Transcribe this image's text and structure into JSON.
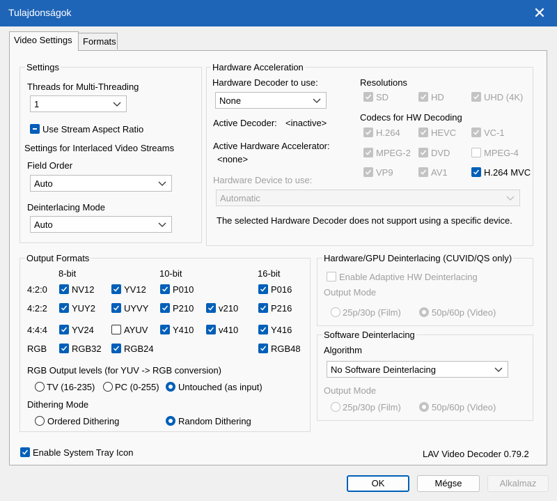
{
  "window": {
    "title": "Tulajdonságok"
  },
  "tabs": [
    "Video Settings",
    "Formats"
  ],
  "settings": {
    "title": "Settings",
    "threads_label": "Threads for Multi-Threading",
    "threads_value": "1",
    "aspect_label": "Use Stream Aspect Ratio",
    "interlaced_label": "Settings for Interlaced Video Streams",
    "field_order_label": "Field Order",
    "field_order_value": "Auto",
    "deint_mode_label": "Deinterlacing Mode",
    "deint_mode_value": "Auto"
  },
  "hwaccel": {
    "title": "Hardware Acceleration",
    "decoder_label": "Hardware Decoder to use:",
    "decoder_value": "None",
    "active_decoder_label": "Active Decoder:",
    "active_decoder_value": "<inactive>",
    "active_accel_label": "Active Hardware Accelerator:",
    "active_accel_value": "<none>",
    "device_label": "Hardware Device to use:",
    "device_value": "Automatic",
    "device_note": "The selected Hardware Decoder does not support using a specific device.",
    "resolutions_label": "Resolutions",
    "res_sd": "SD",
    "res_hd": "HD",
    "res_uhd": "UHD (4K)",
    "codecs_label": "Codecs for HW Decoding",
    "c_h264": "H.264",
    "c_hevc": "HEVC",
    "c_vc1": "VC-1",
    "c_mpeg2": "MPEG-2",
    "c_dvd": "DVD",
    "c_mpeg4": "MPEG-4",
    "c_vp9": "VP9",
    "c_av1": "AV1",
    "c_h264mvc": "H.264 MVC"
  },
  "output": {
    "title": "Output Formats",
    "h8": "8-bit",
    "h10": "10-bit",
    "h16": "16-bit",
    "r420": "4:2:0",
    "r422": "4:2:2",
    "r444": "4:4:4",
    "rrgb": "RGB",
    "nv12": "NV12",
    "yv12": "YV12",
    "p010": "P010",
    "p016": "P016",
    "yuy2": "YUY2",
    "uyvy": "UYVY",
    "p210": "P210",
    "v210": "v210",
    "p216": "P216",
    "yv24": "YV24",
    "ayuv": "AYUV",
    "y410": "Y410",
    "v410": "v410",
    "y416": "Y416",
    "rgb32": "RGB32",
    "rgb24": "RGB24",
    "rgb48": "RGB48",
    "levels_label": "RGB Output levels (for YUV -> RGB conversion)",
    "lv_tv": "TV (16-235)",
    "lv_pc": "PC (0-255)",
    "lv_untouched": "Untouched (as input)",
    "dither_label": "Dithering Mode",
    "dither_ordered": "Ordered Dithering",
    "dither_random": "Random Dithering"
  },
  "hwdeint": {
    "title": "Hardware/GPU Deinterlacing (CUVID/QS only)",
    "adaptive_label": "Enable Adaptive HW Deinterlacing",
    "output_mode_label": "Output Mode",
    "film": "25p/30p (Film)",
    "video": "50p/60p (Video)"
  },
  "swdeint": {
    "title": "Software Deinterlacing",
    "algorithm_label": "Algorithm",
    "algorithm_value": "No Software Deinterlacing",
    "output_mode_label": "Output Mode",
    "film": "25p/30p (Film)",
    "video": "50p/60p (Video)"
  },
  "tray_label": "Enable System Tray Icon",
  "version": "LAV Video Decoder 0.79.2",
  "buttons": {
    "ok": "OK",
    "cancel": "Mégse",
    "apply": "Alkalmaz"
  },
  "colors": {
    "titlebar": "#1e64b7",
    "accent": "#005fb8"
  }
}
